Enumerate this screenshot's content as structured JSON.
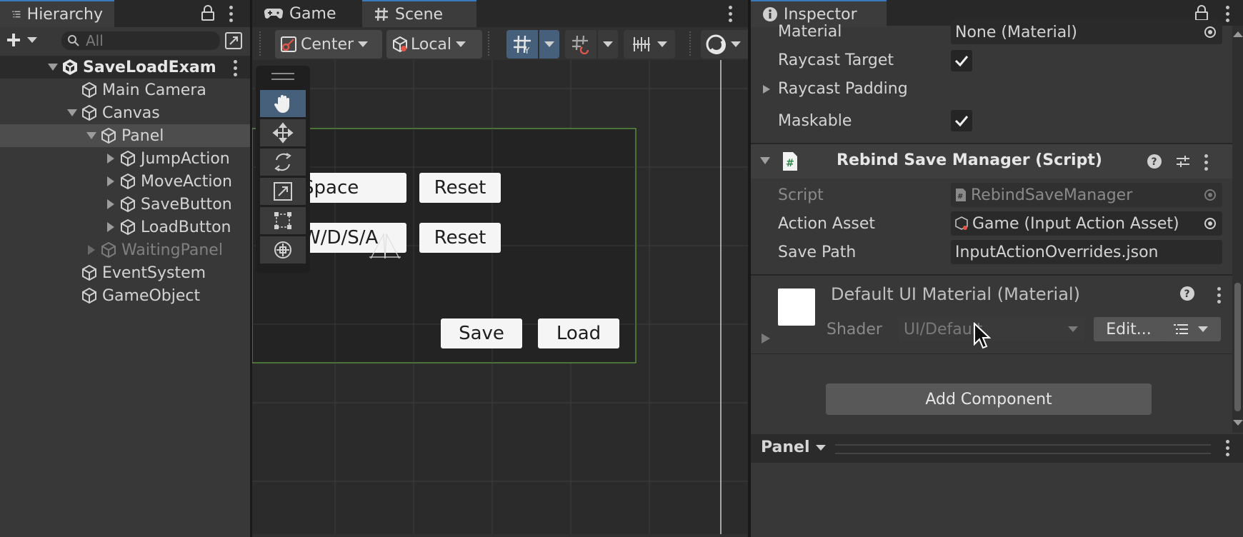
{
  "hierarchy": {
    "tab_label": "Hierarchy",
    "search_placeholder": "All",
    "items": [
      {
        "label": "SaveLoadExam",
        "level": 0,
        "arrow": "down",
        "root": true
      },
      {
        "label": "Main Camera",
        "level": 1,
        "arrow": "none"
      },
      {
        "label": "Canvas",
        "level": 1,
        "arrow": "down"
      },
      {
        "label": "Panel",
        "level": 2,
        "arrow": "down",
        "selected": true
      },
      {
        "label": "JumpAction",
        "level": 3,
        "arrow": "right"
      },
      {
        "label": "MoveAction",
        "level": 3,
        "arrow": "right"
      },
      {
        "label": "SaveButton",
        "level": 3,
        "arrow": "right"
      },
      {
        "label": "LoadButton",
        "level": 3,
        "arrow": "right"
      },
      {
        "label": "WaitingPanel",
        "level": 2,
        "arrow": "right",
        "dimmed": true
      },
      {
        "label": "EventSystem",
        "level": 1,
        "arrow": "none"
      },
      {
        "label": "GameObject",
        "level": 1,
        "arrow": "none"
      }
    ]
  },
  "scene_panel": {
    "tabs": [
      {
        "label": "Game",
        "icon": "gamepad-icon"
      },
      {
        "label": "Scene",
        "icon": "grid-hash-icon"
      }
    ],
    "toolbar": {
      "pivot_label": "Center",
      "space_label": "Local"
    },
    "game_ui": {
      "jump_binding": "Space",
      "move_binding": "W/D/S/A",
      "reset_label": "Reset",
      "save_label": "Save",
      "load_label": "Load"
    }
  },
  "inspector": {
    "tab_label": "Inspector",
    "image_props": [
      {
        "label": "Material",
        "value": "None (Material)"
      },
      {
        "label": "Raycast Target",
        "checked": true
      },
      {
        "label": "Raycast Padding",
        "foldout": true
      },
      {
        "label": "Maskable",
        "checked": true
      }
    ],
    "component": {
      "title": "Rebind Save Manager (Script)",
      "props": [
        {
          "label": "Script",
          "value": "RebindSaveManager",
          "disabled": true
        },
        {
          "label": "Action Asset",
          "value": "Game (Input Action Asset)"
        },
        {
          "label": "Save Path",
          "value": "InputActionOverrides.json"
        }
      ]
    },
    "material": {
      "title": "Default UI Material (Material)",
      "shader_label": "Shader",
      "shader_value": "UI/Default",
      "edit_label": "Edit..."
    },
    "add_component_label": "Add Component",
    "footer_label": "Panel"
  },
  "colors": {
    "accent_blue": "#3a79bb",
    "selection": "#46607c",
    "rect_outline": "#6fbf4a"
  }
}
